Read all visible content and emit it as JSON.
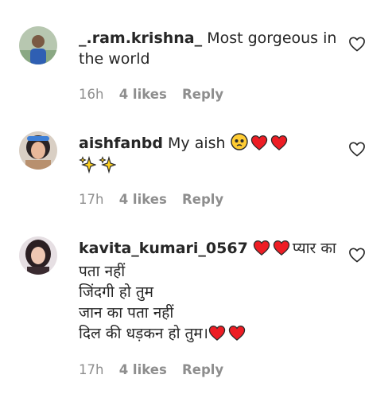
{
  "comments": [
    {
      "username": "_.ram.krishna_",
      "lines": [
        "Most gorgeous in",
        "the world"
      ],
      "time": "16h",
      "likes": "4 likes",
      "reply": "Reply",
      "avatar_icon": "boy-avatar"
    },
    {
      "username": "aishfanbd",
      "lines": [
        "My aish"
      ],
      "emojis_line1": [
        "pleading-face-icon",
        "red-heart-icon",
        "red-heart-icon"
      ],
      "emojis_line2": [
        "sparkles-icon",
        "sparkles-icon"
      ],
      "time": "17h",
      "likes": "4 likes",
      "reply": "Reply",
      "avatar_icon": "woman-avatar"
    },
    {
      "username": "kavita_kumari_0567",
      "lines": [
        "प्यार का",
        "पता नहीं",
        "जिंदगी हो तुम",
        "जान का पता नहीं",
        "दिल की धड़कन हो तुम।"
      ],
      "time": "17h",
      "likes": "4 likes",
      "reply": "Reply",
      "avatar_icon": "woman-avatar-2"
    }
  ],
  "colors": {
    "text": "#262626",
    "meta": "#8e8e8e",
    "heart": "#ed1d24"
  }
}
